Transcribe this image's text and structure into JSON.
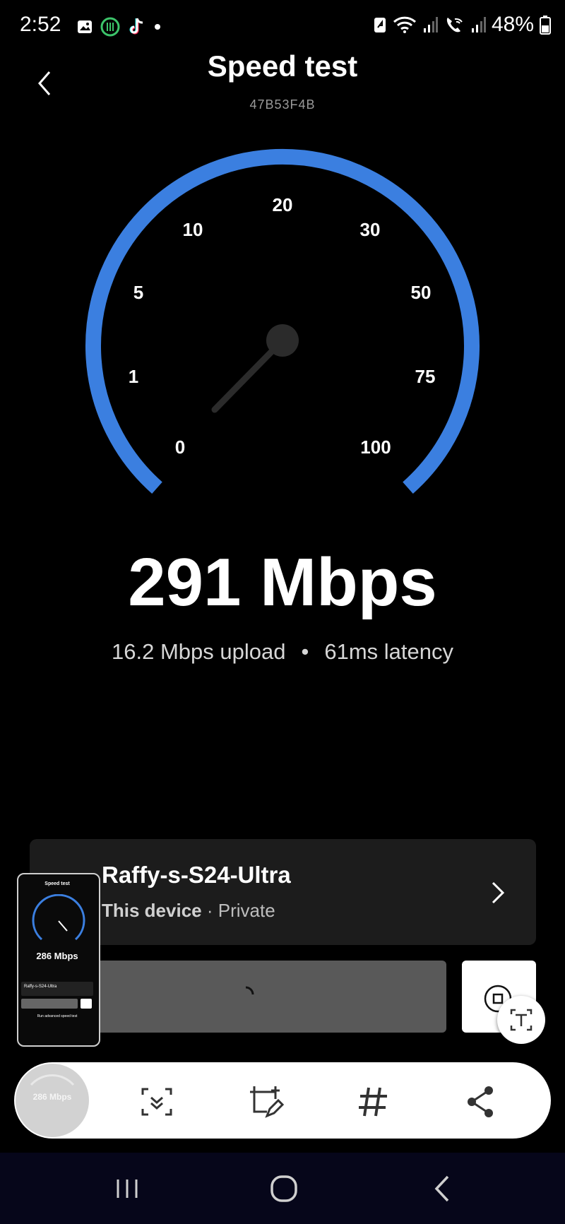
{
  "status_bar": {
    "time": "2:52",
    "battery": "48%",
    "icons": [
      "gallery-icon",
      "food-icon",
      "tiktok-icon",
      "dot-icon",
      "battery-saver-icon",
      "wifi-icon",
      "signal-icon",
      "wifi-calling-icon",
      "signal-icon",
      "battery-icon"
    ]
  },
  "header": {
    "title": "Speed test",
    "subtitle": "47B53F4B"
  },
  "gauge": {
    "ticks": [
      "0",
      "1",
      "5",
      "10",
      "20",
      "30",
      "50",
      "75",
      "100"
    ],
    "needle_value": 1.5,
    "arc_color": "#3b7fe0"
  },
  "result": {
    "download": "291 Mbps",
    "upload": "16.2 Mbps upload",
    "separator": "•",
    "latency": "61ms latency"
  },
  "device": {
    "name": "Raffy-s-S24-Ultra",
    "label": "This device",
    "separator": " · ",
    "visibility": "Private"
  },
  "thumbnail": {
    "speed": "286 Mbps",
    "title": "Speed test",
    "device": "Raffy-s-S24-Ultra",
    "button": "Run advanced speed test"
  },
  "toolbar": {
    "preview_speed": "286 Mbps",
    "tools": [
      "scroll-capture-icon",
      "crop-edit-icon",
      "hashtag-icon",
      "share-icon"
    ]
  },
  "navbar": {
    "buttons": [
      "recents-icon",
      "home-icon",
      "back-icon"
    ]
  }
}
